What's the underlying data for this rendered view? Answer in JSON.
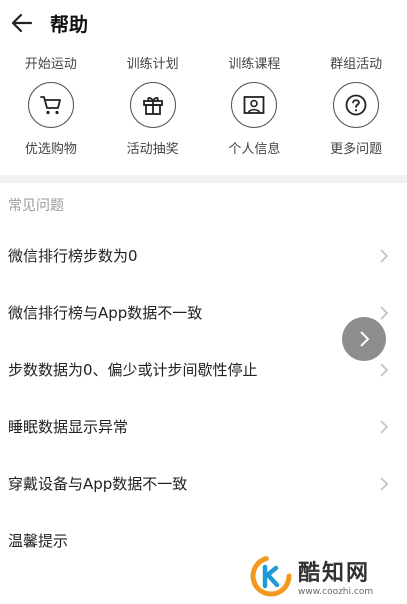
{
  "header": {
    "title": "帮助",
    "back_icon": "arrow-left-icon"
  },
  "categories": [
    "开始运动",
    "训练计划",
    "训练课程",
    "群组活动"
  ],
  "icon_items": [
    {
      "label": "优选购物",
      "icon": "cart-icon"
    },
    {
      "label": "活动抽奖",
      "icon": "gift-icon"
    },
    {
      "label": "个人信息",
      "icon": "id-card-icon"
    },
    {
      "label": "更多问题",
      "icon": "question-icon"
    }
  ],
  "faq": {
    "section_title": "常见问题",
    "items": [
      "微信排行榜步数为0",
      "微信排行榜与App数据不一致",
      "步数数据为0、偏少或计步间歇性停止",
      "睡眠数据显示异常",
      "穿戴设备与App数据不一致",
      "温馨提示"
    ]
  },
  "watermark": {
    "name": "酷知网",
    "url": "www.coozhi.com"
  },
  "colors": {
    "float_button": "#8d8d8d",
    "divider": "#f0f0f0",
    "logo_orange": "#f39a1e",
    "logo_blue": "#1e9bd7"
  }
}
